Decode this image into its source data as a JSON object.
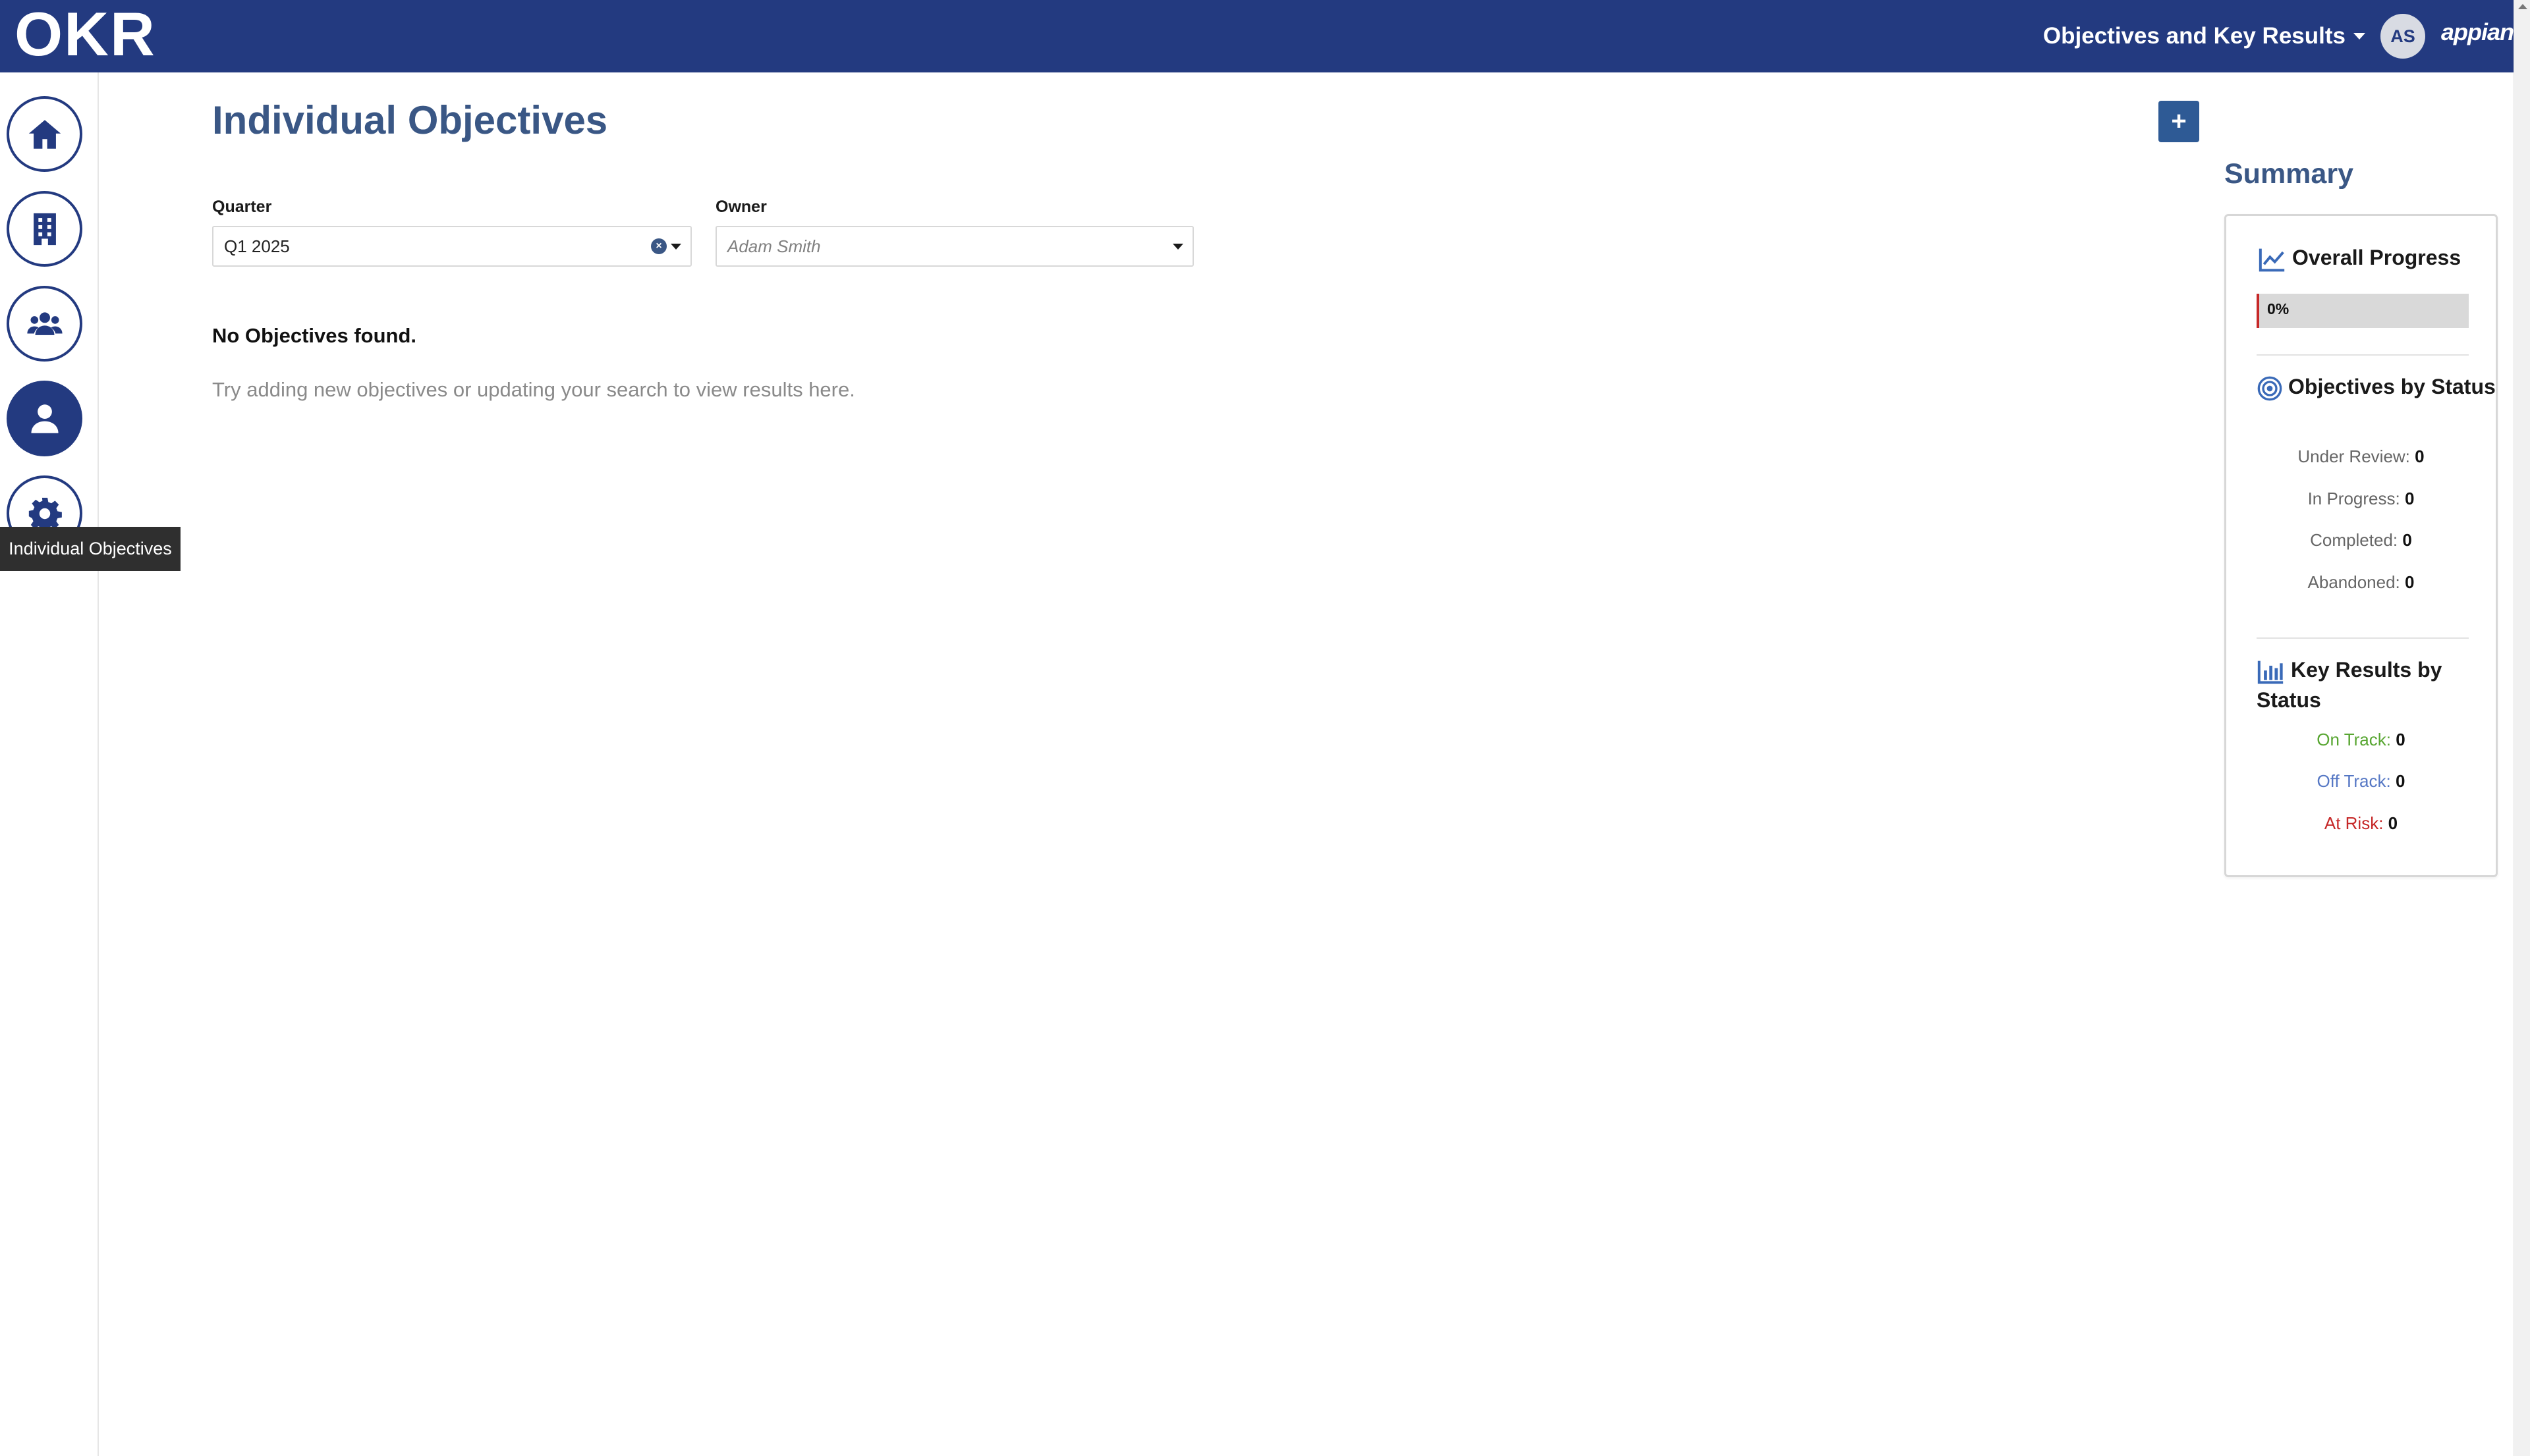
{
  "header": {
    "logo": "OKR",
    "app_menu_label": "Objectives and Key Results",
    "avatar_initials": "AS",
    "brand": "appian"
  },
  "nav": {
    "items": [
      {
        "name": "home",
        "icon": "home-icon"
      },
      {
        "name": "organization",
        "icon": "building-icon"
      },
      {
        "name": "teams",
        "icon": "users-icon"
      },
      {
        "name": "individual",
        "icon": "user-icon",
        "active": true
      },
      {
        "name": "settings",
        "icon": "gear-icon"
      }
    ],
    "tooltip": "Individual Objectives"
  },
  "main": {
    "title": "Individual Objectives",
    "add_button": "+",
    "filters": {
      "quarter_label": "Quarter",
      "quarter_value": "Q1 2025",
      "owner_label": "Owner",
      "owner_placeholder": "Adam Smith"
    },
    "empty_title": "No Objectives found.",
    "empty_text": "Try adding new objectives or updating your search to view results here."
  },
  "summary": {
    "heading": "Summary",
    "overall_progress_label": "Overall Progress",
    "overall_progress_value": 0,
    "overall_progress_text": "0%",
    "objectives_by_status_label": "Objectives by Status",
    "objectives_status": [
      {
        "label": "Under Review:",
        "value": "0"
      },
      {
        "label": "In Progress:",
        "value": "0"
      },
      {
        "label": "Completed:",
        "value": "0"
      },
      {
        "label": "Abandoned:",
        "value": "0"
      }
    ],
    "key_results_by_status_label": "Key Results by Status",
    "key_results_status": [
      {
        "label": "On Track:",
        "value": "0",
        "color": "#58a632"
      },
      {
        "label": "Off Track:",
        "value": "0",
        "color": "#5577c4"
      },
      {
        "label": "At Risk:",
        "value": "0",
        "color": "#c62828"
      }
    ]
  },
  "colors": {
    "header_bg": "#233a80",
    "title": "#3a5785",
    "accent_button": "#2e5a95",
    "progress_bar": "#c62828"
  }
}
